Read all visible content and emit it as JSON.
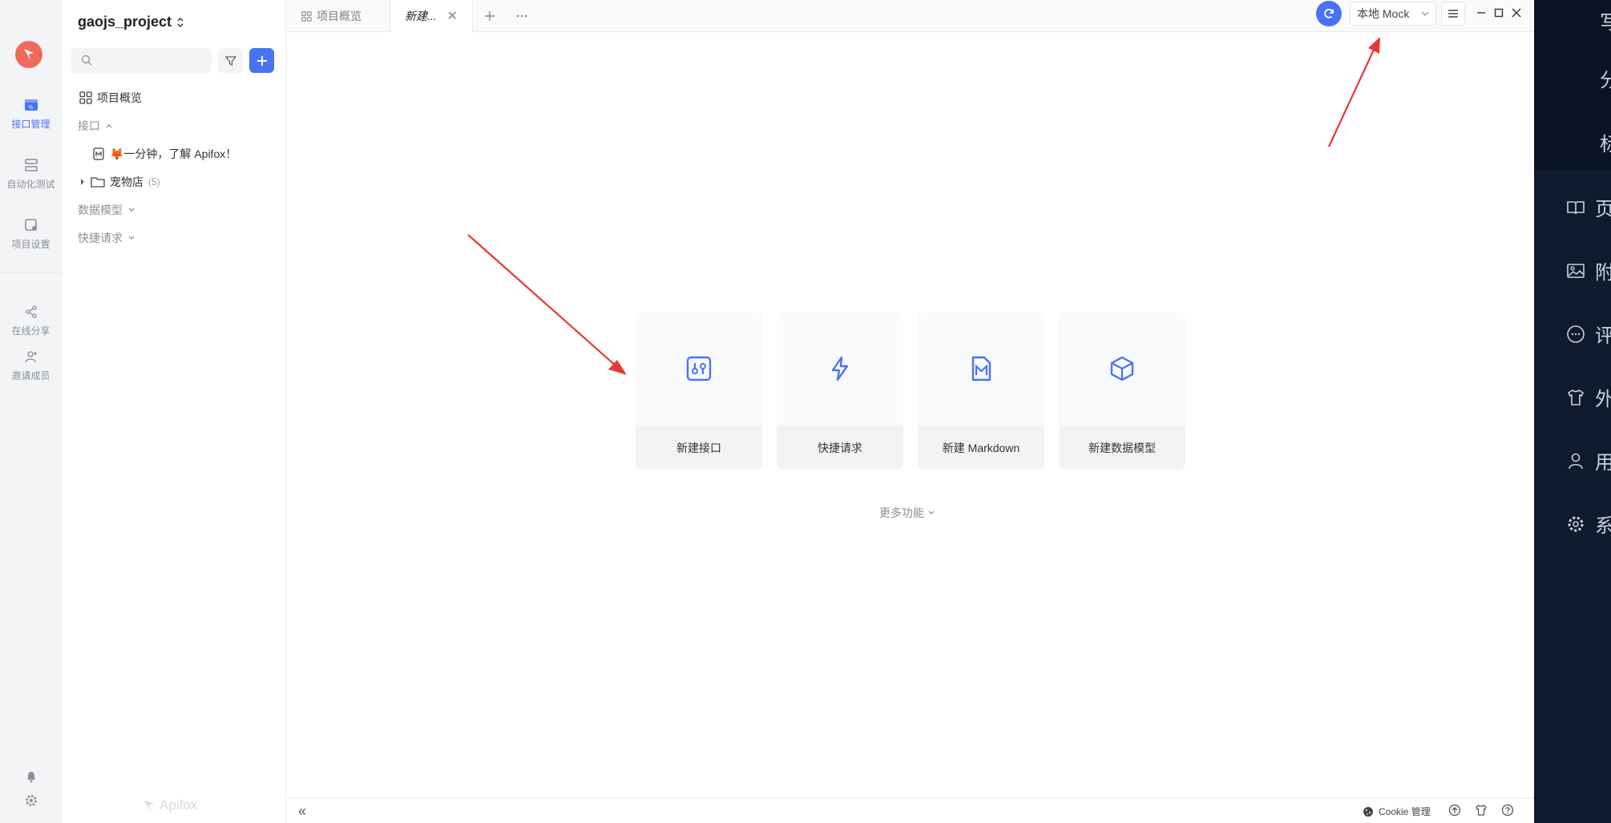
{
  "project": {
    "name": "gaojs_project"
  },
  "rail": {
    "items": [
      {
        "label": "接口管理"
      },
      {
        "label": "自动化测试"
      },
      {
        "label": "项目设置"
      },
      {
        "label": "在线分享"
      },
      {
        "label": "邀请成员"
      }
    ]
  },
  "sidebar": {
    "search_placeholder": "",
    "overview": "项目概览",
    "sections": {
      "api": "接口",
      "api_doc": "🦊一分钟，了解 Apifox！",
      "folder": "宠物店",
      "folder_count": "(5)",
      "data_model": "数据模型",
      "quick_request": "快捷请求"
    },
    "brand": "Apifox"
  },
  "tabs": [
    {
      "label": "项目概览"
    },
    {
      "label": "新建..."
    }
  ],
  "toolbar": {
    "mock_env": "本地 Mock"
  },
  "cards": [
    {
      "label": "新建接口",
      "icon": "api-icon"
    },
    {
      "label": "快捷请求",
      "icon": "lightning-icon"
    },
    {
      "label": "新建 Markdown",
      "icon": "markdown-icon"
    },
    {
      "label": "新建数据模型",
      "icon": "cube-icon"
    }
  ],
  "more_functions": "更多功能",
  "footer": {
    "cookie": "Cookie 管理"
  },
  "dark_panel": {
    "rows": [
      "写",
      "分",
      "标",
      "页",
      "附",
      "评",
      "外",
      "用",
      "系"
    ]
  },
  "colors": {
    "accent": "#4a72f5",
    "annotation": "#e53935",
    "dark_panel": "#0e1a2e"
  }
}
